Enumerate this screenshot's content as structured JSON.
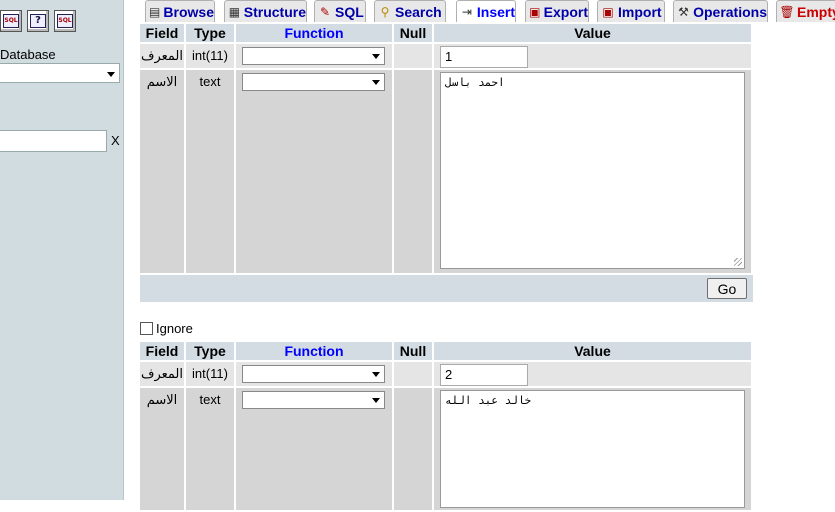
{
  "nav": {
    "icons": [
      "sql-query-icon",
      "help-icon",
      "sql-docs-icon"
    ],
    "database_label": "Database",
    "database_selected": "",
    "filter_value": "",
    "filter_clear": "X"
  },
  "tabs": [
    {
      "label": "Browse",
      "icon": "browse-icon"
    },
    {
      "label": "Structure",
      "icon": "structure-icon"
    },
    {
      "label": "SQL",
      "icon": "sql-icon"
    },
    {
      "label": "Search",
      "icon": "search-icon"
    },
    {
      "label": "Insert",
      "icon": "insert-icon",
      "active": true
    },
    {
      "label": "Export",
      "icon": "export-icon"
    },
    {
      "label": "Import",
      "icon": "import-icon"
    },
    {
      "label": "Operations",
      "icon": "operations-icon"
    },
    {
      "label": "Empty",
      "icon": "empty-icon"
    }
  ],
  "headers": {
    "field": "Field",
    "type": "Type",
    "function": "Function",
    "null": "Null",
    "value": "Value"
  },
  "records": [
    {
      "row1": {
        "field": "المعرف",
        "type": "int(11)",
        "function": "",
        "value": "1"
      },
      "row2": {
        "field": "الاسم",
        "type": "text",
        "function": "",
        "value": "احمد باسل"
      }
    },
    {
      "row1": {
        "field": "المعرف",
        "type": "int(11)",
        "function": "",
        "value": "2"
      },
      "row2": {
        "field": "الاسم",
        "type": "text",
        "function": "",
        "value": "خالد عبد الله"
      }
    }
  ],
  "go_label": "Go",
  "ignore_label": "Ignore"
}
